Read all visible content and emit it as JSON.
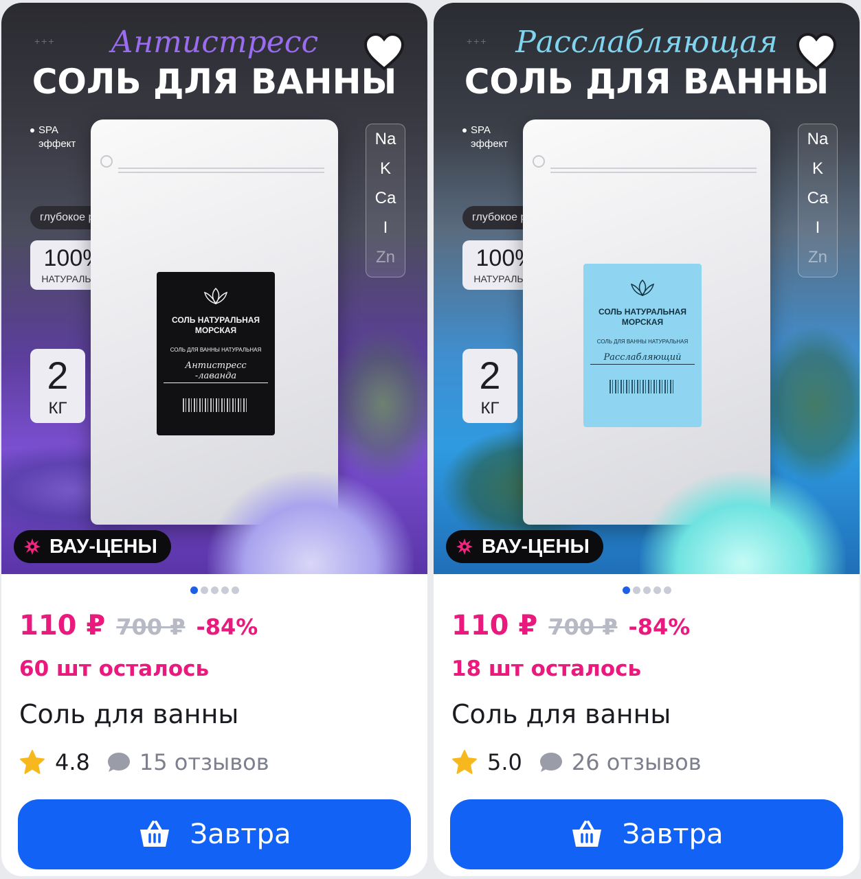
{
  "products": [
    {
      "theme": "violet",
      "script_title": "Антистресс",
      "main_title": "СОЛЬ ДЛЯ ВАННЫ",
      "spa_line1": "SPA",
      "spa_line2": "эффект",
      "elements": [
        "Na",
        "K",
        "Ca",
        "I",
        "Zn"
      ],
      "relax_badge": "глубокое расслабление",
      "natural_percent": "100%",
      "natural_text": "НАТУРАЛЬНО",
      "weight_value": "2",
      "weight_unit": "КГ",
      "pack_label": {
        "name": "СОЛЬ НАТУРАЛЬНАЯ МОРСКАЯ",
        "sub": "СОЛЬ ДЛЯ ВАННЫ НАТУРАЛЬНАЯ",
        "variant": "Антистресс -лаванда"
      },
      "promo_label": "ВАУ-ЦЕНЫ",
      "image_count": 5,
      "image_active_index": 0,
      "price": "110 ₽",
      "old_price": "700 ₽",
      "discount": "-84%",
      "stock": "60 шт осталось",
      "title": "Соль для ванны",
      "rating": "4.8",
      "reviews": "15 отзывов",
      "button_label": "Завтра",
      "favorite_icon": "heart-icon",
      "button_icon": "basket-icon"
    },
    {
      "theme": "blue",
      "script_title": "Расслабляющая",
      "main_title": "СОЛЬ ДЛЯ ВАННЫ",
      "spa_line1": "SPA",
      "spa_line2": "эффект",
      "elements": [
        "Na",
        "K",
        "Ca",
        "I",
        "Zn"
      ],
      "relax_badge": "глубокое расслабление",
      "natural_percent": "100%",
      "natural_text": "НАТУРАЛЬНО",
      "weight_value": "2",
      "weight_unit": "КГ",
      "pack_label": {
        "name": "СОЛЬ НАТУРАЛЬНАЯ МОРСКАЯ",
        "sub": "СОЛЬ ДЛЯ ВАННЫ НАТУРАЛЬНАЯ",
        "variant": "Расслабляющий"
      },
      "promo_label": "ВАУ-ЦЕНЫ",
      "image_count": 5,
      "image_active_index": 0,
      "price": "110 ₽",
      "old_price": "700 ₽",
      "discount": "-84%",
      "stock": "18 шт осталось",
      "title": "Соль для ванны",
      "rating": "5.0",
      "reviews": "26 отзывов",
      "button_label": "Завтра",
      "favorite_icon": "heart-icon",
      "button_icon": "basket-icon"
    }
  ],
  "colors": {
    "accent_pink": "#e9197d",
    "button_blue": "#1162f5",
    "star_yellow": "#f6b81c",
    "muted_gray": "#7d7f8c"
  }
}
